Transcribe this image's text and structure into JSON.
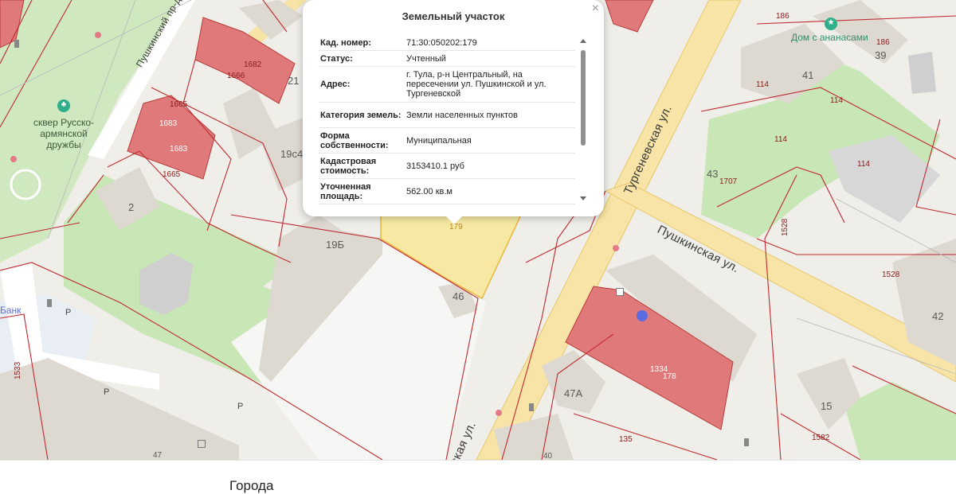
{
  "popup": {
    "title": "Земельный участок",
    "close_glyph": "×",
    "rows": [
      {
        "key": "Кад. номер:",
        "value": "71:30:050202:179"
      },
      {
        "key": "Статус:",
        "value": "Учтенный"
      },
      {
        "key": "Адрес:",
        "value": "г. Тула, р-н Центральный, на пересечении ул. Пушкинской и ул. Тургеневской"
      },
      {
        "key": "Категория земель:",
        "value": "Земли населенных пунктов"
      },
      {
        "key": "Форма собственности:",
        "value": "Муниципальная"
      },
      {
        "key": "Кадастровая стоимость:",
        "value": "3153410.1 руб"
      },
      {
        "key": "Уточненная площадь:",
        "value": "562.00 кв.м"
      }
    ]
  },
  "map": {
    "streets": {
      "pushkinsky_pr": "Пушкинский пр-д",
      "turgenevskaya": "Тургеневская ул.",
      "pushkinskaya": "Пушкинская ул.",
      "turgenevskaya_bottom": "ская ул."
    },
    "park": "сквер Русско-армянской дружбы",
    "poi": {
      "dom_s_ananasami": "Дом с ананасами",
      "bank": "Банк"
    },
    "building_numbers": {
      "b21": "21",
      "b19c4": "19с4",
      "b2": "2",
      "b19b": "19Б",
      "b46": "46",
      "b41": "41",
      "b39": "39",
      "b43": "43",
      "b42": "42",
      "b47a": "47А",
      "b15": "15",
      "b47": "47",
      "b40": "40"
    },
    "cadastral": {
      "c1682": "1682",
      "c1666": "1666",
      "c1665a": "1665",
      "c1683a": "1683",
      "c1683b": "1683",
      "c1665b": "1665",
      "c179": "179",
      "c186a": "186",
      "c186b": "186",
      "c114a": "114",
      "c114b": "114",
      "c114c": "114",
      "c114d": "114",
      "c1707": "1707",
      "c1528a": "1528",
      "c1528b": "1528",
      "c1533": "1533",
      "c1334": "1334",
      "c178": "178",
      "c135": "135",
      "c1582": "1582"
    },
    "parking": "Р"
  },
  "footer": {
    "title": "Города"
  }
}
